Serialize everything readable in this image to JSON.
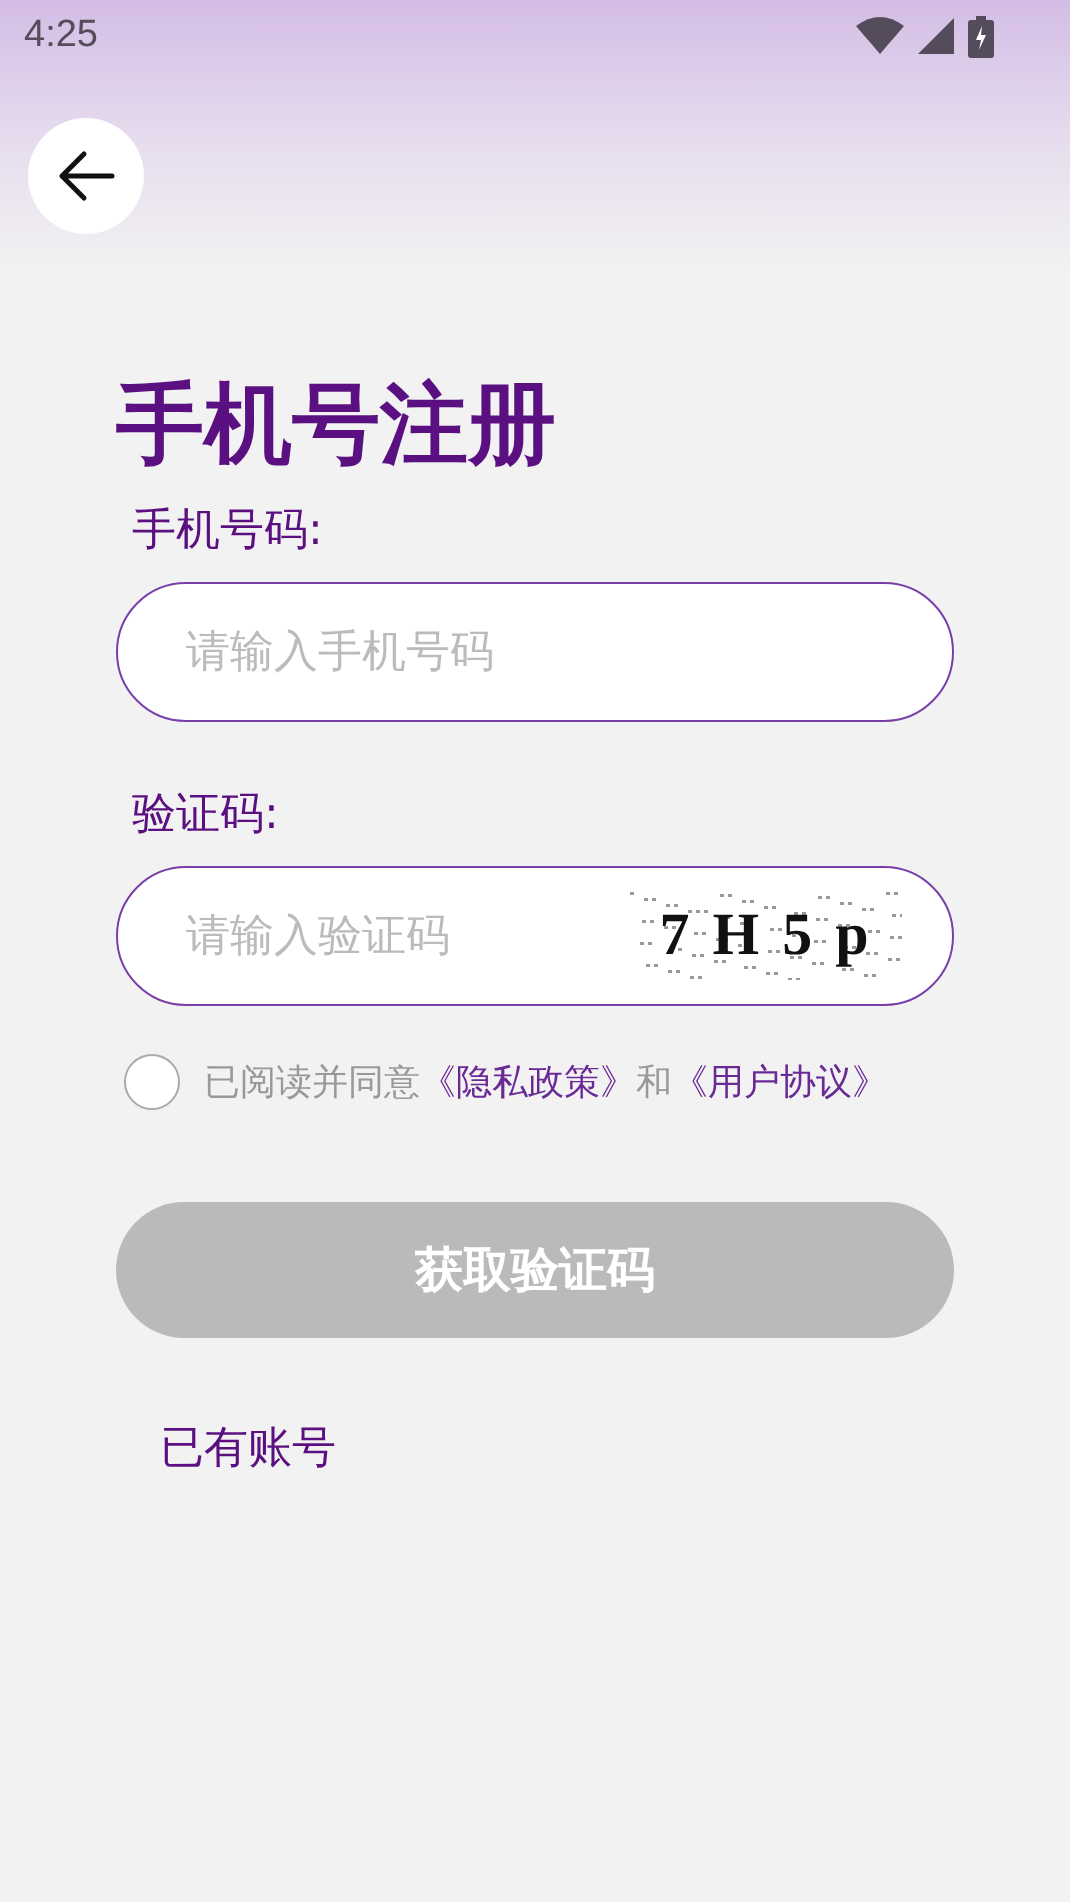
{
  "status_bar": {
    "time": "4:25"
  },
  "title": "手机号注册",
  "phone": {
    "label": "手机号码:",
    "placeholder": "请输入手机号码"
  },
  "code": {
    "label": "验证码:",
    "placeholder": "请输入验证码",
    "captcha": "7 H 5 p"
  },
  "agreement": {
    "checked": false,
    "parts": [
      {
        "kind": "text",
        "text": "已阅读并同意"
      },
      {
        "kind": "link",
        "text": "《隐私政策》"
      },
      {
        "kind": "text",
        "text": "和"
      },
      {
        "kind": "link",
        "text": "《用户协议》"
      }
    ]
  },
  "submit": {
    "label": "获取验证码",
    "disabled": true
  },
  "login_link": "已有账号"
}
